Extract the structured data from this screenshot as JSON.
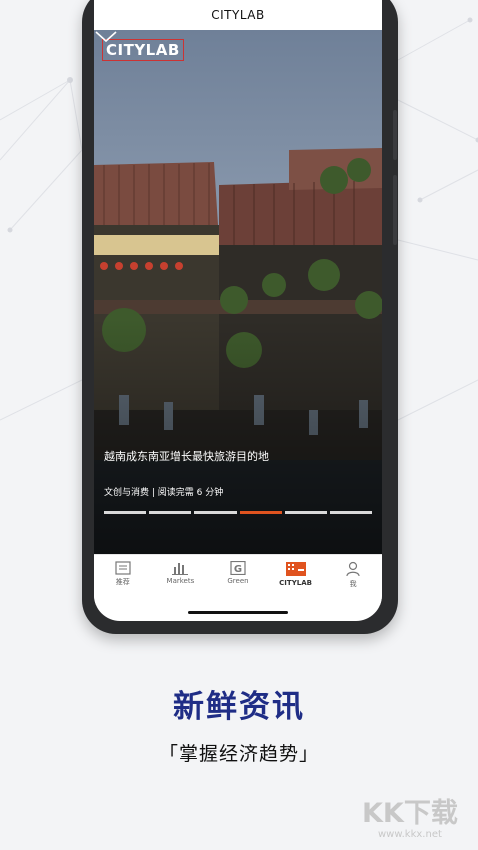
{
  "app": {
    "title": "CITYLAB"
  },
  "hero": {
    "logo": "CITYLAB",
    "headline": "越南成东南亚增长最快旅游目的地",
    "meta": "文创与消费 | 阅读完需 6 分钟",
    "progress": {
      "segments": 6,
      "active_index": 3
    }
  },
  "tabbar": {
    "items": [
      {
        "label": "推荐",
        "icon": "news-icon",
        "active": false
      },
      {
        "label": "Markets",
        "icon": "bar-chart-icon",
        "active": false
      },
      {
        "label": "Green",
        "icon": "green-g-icon",
        "active": false
      },
      {
        "label": "CITYLAB",
        "icon": "city-building-icon",
        "active": true
      },
      {
        "label": "我",
        "icon": "person-icon",
        "active": false
      }
    ]
  },
  "promo": {
    "title": "新鲜资讯",
    "subtitle": "「掌握经济趋势」"
  },
  "watermark": {
    "text": "KK下载",
    "url": "www.kkx.net"
  },
  "colors": {
    "accent": "#e0531f",
    "title": "#1f2d86"
  }
}
